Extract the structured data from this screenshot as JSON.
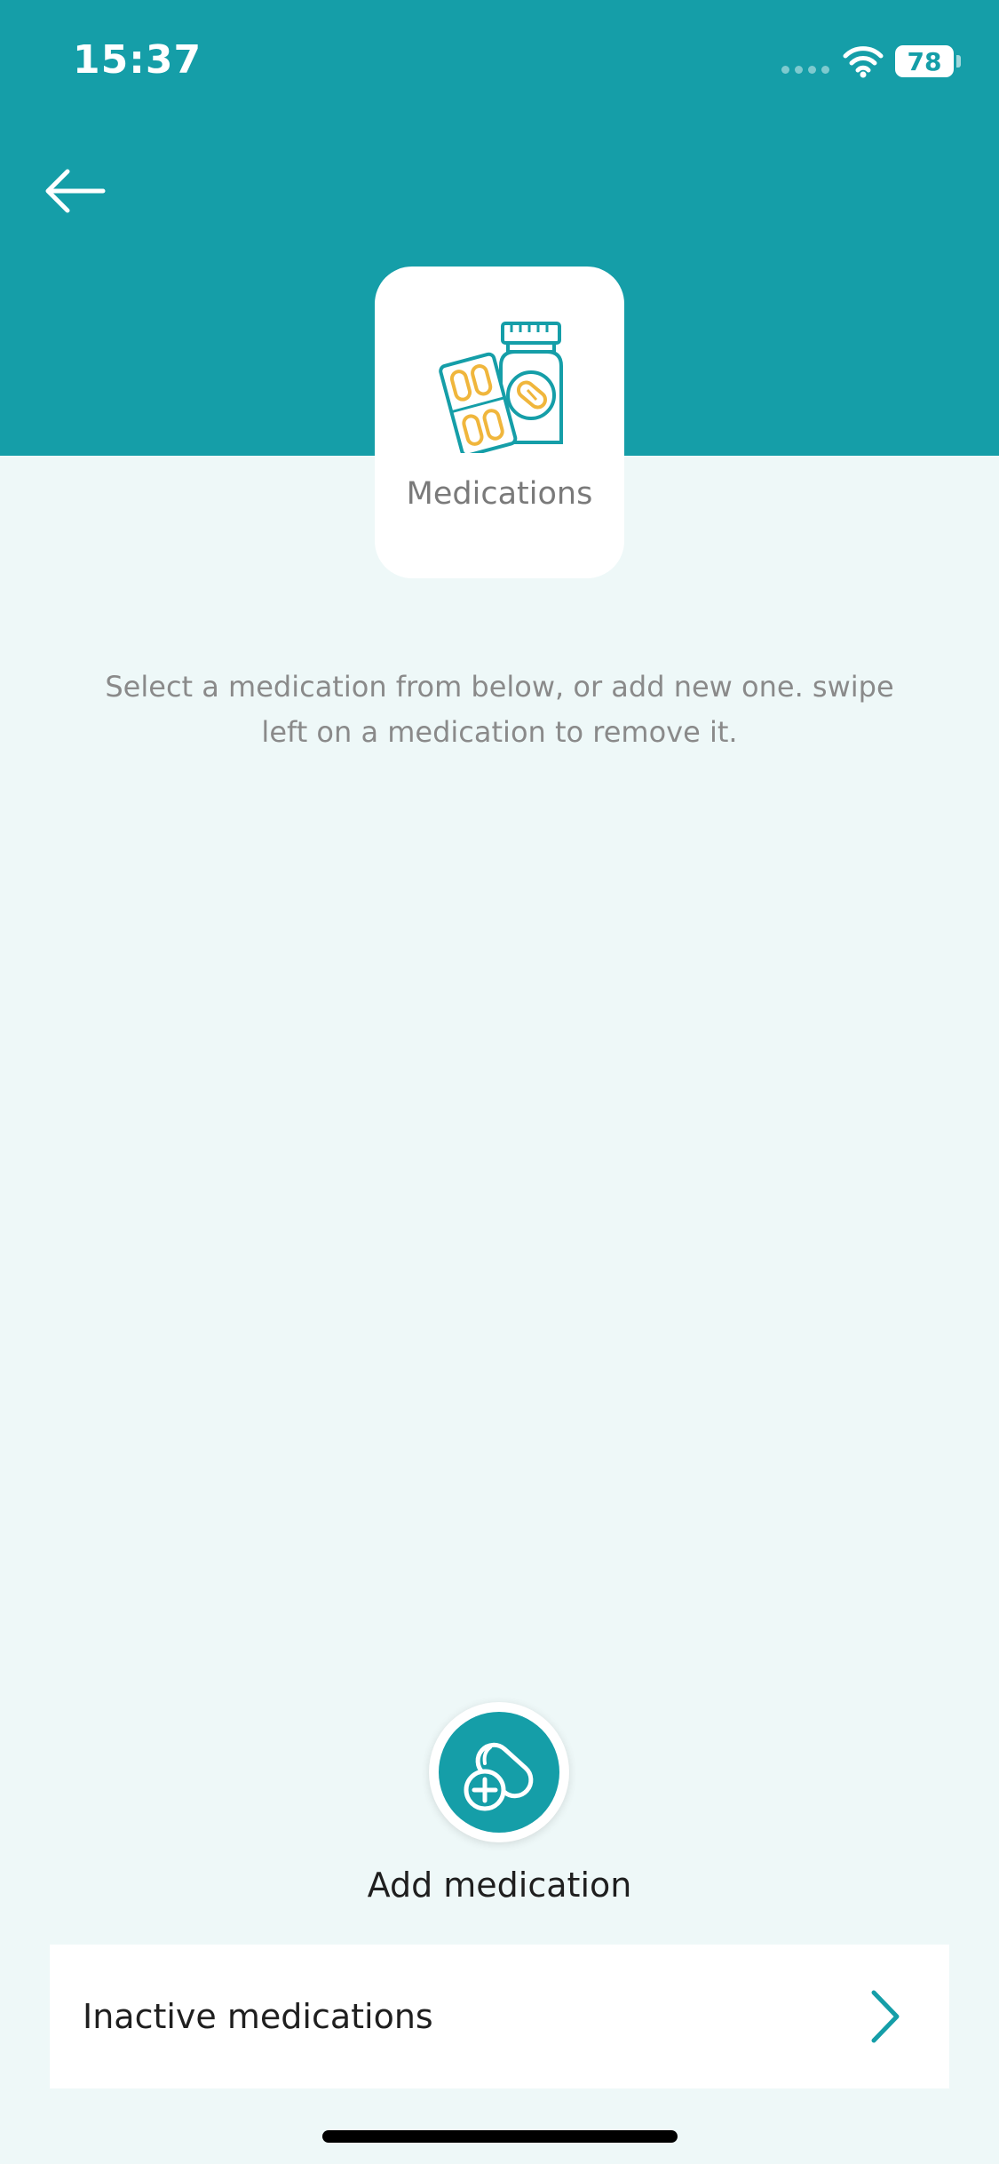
{
  "status_bar": {
    "time": "15:37",
    "battery": "78"
  },
  "header": {
    "category_label": "Medications"
  },
  "main": {
    "instructions": "Select a medication from below, or add new one. swipe left on a medication to remove it."
  },
  "actions": {
    "add_label": "Add medication",
    "inactive_label": "Inactive medications"
  },
  "colors": {
    "accent": "#159ea8",
    "background": "#eef8f8",
    "pill_yellow": "#f0b63c"
  },
  "icons": {
    "back": "arrow-left-icon",
    "category": "medications-icon",
    "add": "pill-plus-icon",
    "chevron": "chevron-right-icon"
  }
}
